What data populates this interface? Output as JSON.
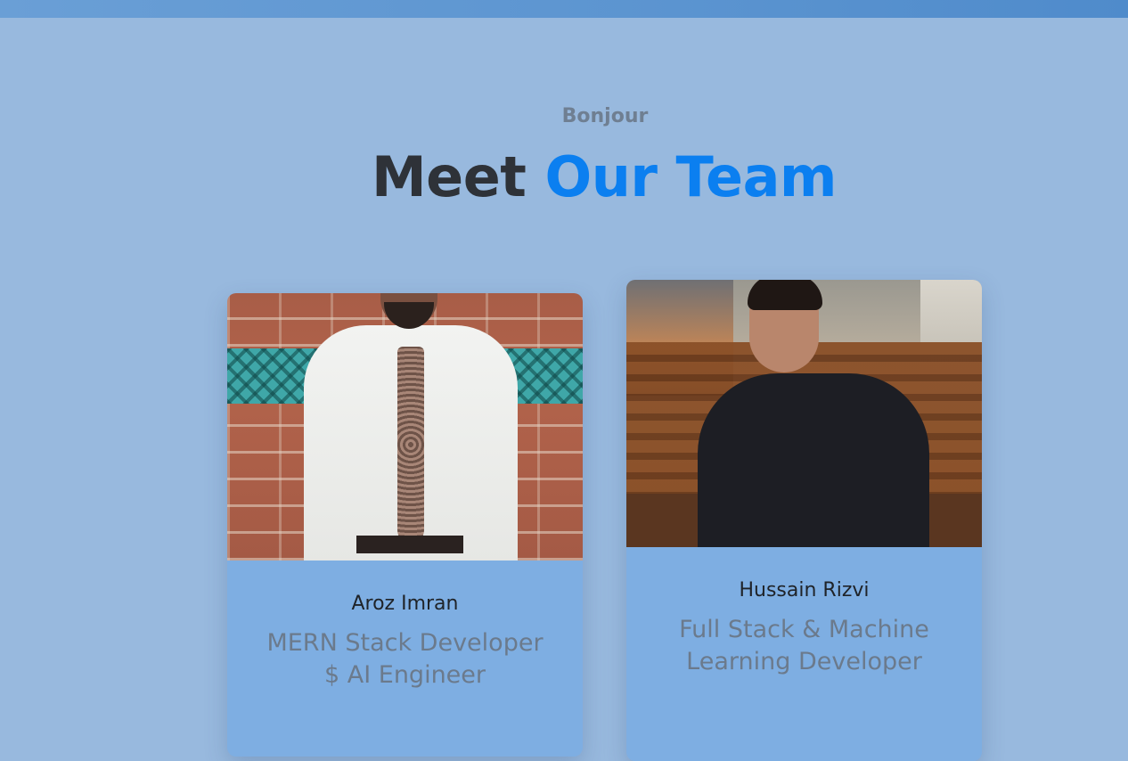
{
  "header": {
    "subtitle": "Bonjour",
    "title_prefix": "Meet",
    "title_accent": "Our Team"
  },
  "team": [
    {
      "name": "Aroz Imran",
      "role": "MERN Stack Developer $ AI Engineer"
    },
    {
      "name": "Hussain Rizvi",
      "role": "Full Stack & Machine Learning Developer"
    }
  ],
  "colors": {
    "background": "#98b9de",
    "accent": "#0b7ff0",
    "card": "#7eaee2",
    "heading": "#2e3238"
  }
}
